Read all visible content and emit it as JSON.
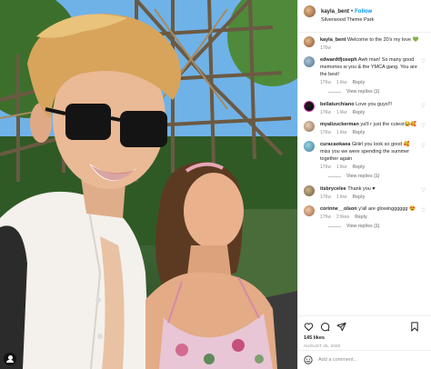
{
  "header": {
    "username": "kayla_bent",
    "separator": "•",
    "follow_label": "Follow",
    "location": "Silverwood Theme Park"
  },
  "caption": {
    "username": "kayla_bent",
    "text": "Welcome to the 20's my love 💚",
    "time": "176w"
  },
  "comments": [
    {
      "username": "edwardtfjoseph",
      "text": "Awh man! So many good memories w you & the YMCA gang. You are the best!",
      "time": "176w",
      "likes": "1 like",
      "reply": "Reply",
      "view_replies": "View replies (1)"
    },
    {
      "username": "bellaturchiano",
      "text": "Love you guys!!!",
      "time": "176w",
      "likes": "1 like",
      "reply": "Reply"
    },
    {
      "username": "myalizuckerman",
      "text": "ya'll r just the cutest😂🥰",
      "time": "176w",
      "likes": "1 like",
      "reply": "Reply"
    },
    {
      "username": "curacaokaea",
      "text": "Giiiirl you look so good 🥰 miss you we were spending the summer together again",
      "time": "176w",
      "likes": "1 like",
      "reply": "Reply",
      "view_replies": "View replies (1)"
    },
    {
      "username": "itsbrycelee",
      "text": "Thank you ♥",
      "time": "176w",
      "likes": "1 like",
      "reply": "Reply"
    },
    {
      "username": "corinne__olson",
      "text": "y'all are glowingggggg 😍",
      "time": "176w",
      "likes": "2 likes",
      "reply": "Reply",
      "view_replies": "View replies (1)"
    }
  ],
  "footer": {
    "likes": "145 likes",
    "date": "AUGUST 25, 2020",
    "comment_placeholder": "Add a comment..."
  },
  "icons": {
    "heart": "heart-icon",
    "comment": "comment-icon",
    "share": "share-icon",
    "save": "bookmark-icon",
    "emoji": "emoji-icon",
    "user_tag": "user-tag-icon"
  }
}
